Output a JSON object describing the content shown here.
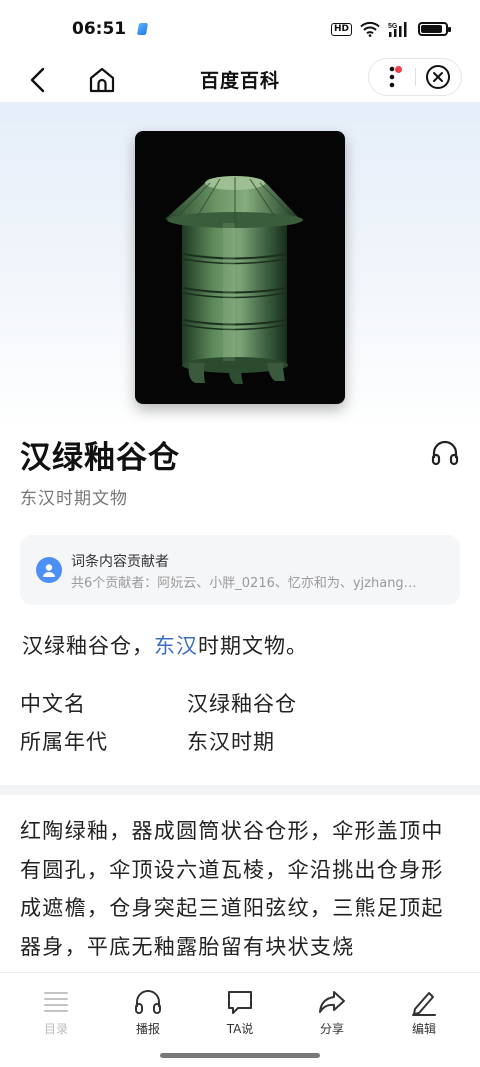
{
  "status_bar": {
    "time": "06:51",
    "hd": "HD",
    "network": "5G"
  },
  "nav": {
    "title": "百度百科",
    "back_icon": "chevron-left-icon",
    "home_icon": "home-icon",
    "more_icon": "more-vertical-icon",
    "close_icon": "close-circle-icon"
  },
  "entry": {
    "title": "汉绿釉谷仓",
    "subtitle": "东汉时期文物",
    "image_alt": "green-glazed-granary-photo"
  },
  "contributors": {
    "title": "词条内容贡献者",
    "list": "共6个贡献者：阿妧云、小胖_0216、忆亦和为、yjzhang…"
  },
  "summary": {
    "prefix": "汉绿釉谷仓，",
    "link": "东汉",
    "suffix": "时期文物。"
  },
  "basic_info": [
    {
      "label": "中文名",
      "value": "汉绿釉谷仓"
    },
    {
      "label": "所属年代",
      "value": "东汉时期"
    }
  ],
  "body": {
    "text": "红陶绿釉，器成圆筒状谷仓形，伞形盖顶中有圆孔，伞顶设六道瓦棱，伞沿挑出仓身形成遮檐，仓身突起三道阳弦纹，三熊足顶起器身，平底无釉露胎留有块状支烧"
  },
  "toolbar": {
    "items": [
      {
        "label": "目录",
        "icon": "toc-list-icon",
        "enabled": false
      },
      {
        "label": "播报",
        "icon": "headphones-icon",
        "enabled": true
      },
      {
        "label": "TA说",
        "icon": "chat-bubble-icon",
        "enabled": true
      },
      {
        "label": "分享",
        "icon": "share-icon",
        "enabled": true
      },
      {
        "label": "编辑",
        "icon": "edit-pen-icon",
        "enabled": true
      }
    ]
  },
  "colors": {
    "link": "#3d6fbf",
    "accent_dot": "#f23d4f",
    "avatar": "#4c8ff6"
  }
}
